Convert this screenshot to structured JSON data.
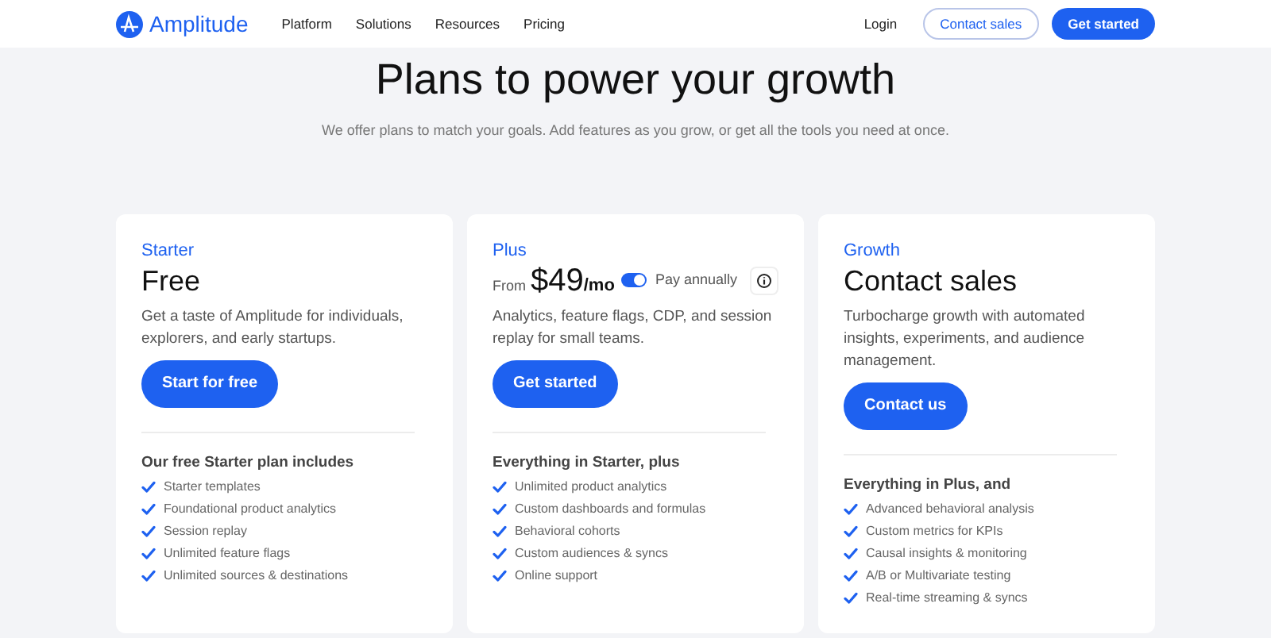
{
  "nav": {
    "brand": "Amplitude",
    "links": [
      "Platform",
      "Solutions",
      "Resources",
      "Pricing"
    ],
    "login": "Login",
    "contact": "Contact sales",
    "cta": "Get started"
  },
  "hero": {
    "title": "Plans to power your growth",
    "subtitle": "We offer plans to match your goals. Add features as you grow, or get all the tools you need at once."
  },
  "plans": [
    {
      "kind": "headline",
      "tier": "Starter",
      "headline": "Free",
      "description": "Get a taste of Amplitude for individuals, explorers, and early startups.",
      "button": "Start for free",
      "features_title": "Our free Starter plan includes",
      "features": [
        "Starter templates",
        "Foundational product analytics",
        "Session replay",
        "Unlimited feature flags",
        "Unlimited sources & destinations"
      ]
    },
    {
      "kind": "price",
      "tier": "Plus",
      "price_prefix": "From",
      "price": "$49",
      "price_unit": "/mo",
      "toggle": {
        "label": "Pay annually",
        "on": true
      },
      "description": "Analytics, feature flags, CDP, and session replay for small teams.",
      "button": "Get started",
      "features_title": "Everything in Starter, plus",
      "features": [
        "Unlimited product analytics",
        "Custom dashboards and formulas",
        "Behavioral cohorts",
        "Custom audiences & syncs",
        "Online support"
      ]
    },
    {
      "kind": "headline",
      "tier": "Growth",
      "headline": "Contact sales",
      "description": "Turbocharge growth with automated insights, experiments, and audience management.",
      "button": "Contact us",
      "features_title": "Everything in Plus, and",
      "features": [
        "Advanced behavioral analysis",
        "Custom metrics for KPIs",
        "Causal insights & monitoring",
        "A/B or Multivariate testing",
        "Real-time streaming & syncs"
      ]
    }
  ]
}
